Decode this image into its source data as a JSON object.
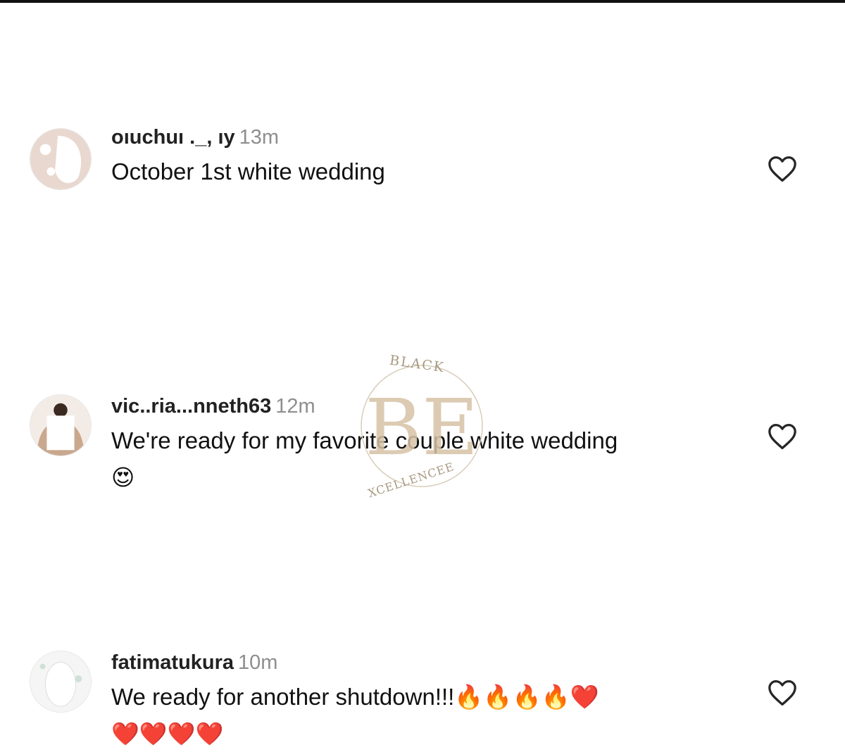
{
  "comments": [
    {
      "username": "oıuchuı     ._,   ıy",
      "time": "13m",
      "text": "October 1st white wedding",
      "emoji": ""
    },
    {
      "username": "vic..ria...nneth63",
      "time": "12m",
      "text": "We're ready for my favorite couple white wedding",
      "emoji": "😍"
    },
    {
      "username": "fatimatukura",
      "time": "10m",
      "text": "We ready for another shutdown!!!🔥🔥🔥🔥❤️",
      "emoji": "❤️❤️❤️❤️"
    }
  ],
  "watermark": {
    "top_text": "BLACK",
    "monogram": "BE",
    "bottom_text": "XCELLENCEE"
  },
  "icons": {
    "like": "heart-outline-icon"
  },
  "colors": {
    "time": "#8e8e8e",
    "watermark": "#a89a82",
    "icon_stroke": "#262626"
  }
}
